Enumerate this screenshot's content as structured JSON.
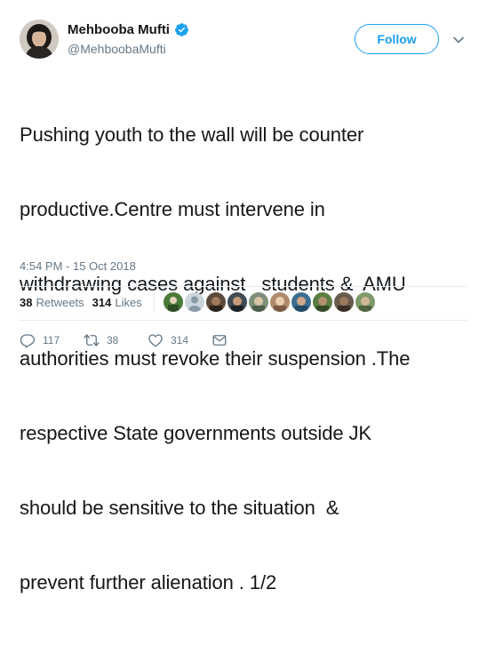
{
  "user": {
    "display_name": "Mehbooba Mufti",
    "handle": "@MehboobaMufti",
    "verified": true
  },
  "follow_label": "Follow",
  "tweet": {
    "lines": [
      "Pushing youth to the wall will be counter",
      "productive.Centre must intervene in",
      "withdrawing cases against   students &  AMU",
      "authorities must revoke their suspension .The",
      "respective State governments outside JK",
      "should be sensitive to the situation  &",
      "prevent further alienation . 1/2"
    ],
    "timestamp": "4:54 PM - 15 Oct 2018"
  },
  "stats": {
    "retweets_count": "38",
    "retweets_label": "Retweets",
    "likes_count": "314",
    "likes_label": "Likes"
  },
  "actions": {
    "reply_count": "117",
    "retweet_count": "38",
    "like_count": "314"
  },
  "colors": {
    "accent": "#1da1f2",
    "text": "#14171a",
    "muted": "#657786",
    "divider": "#e6ecf0"
  },
  "icons": [
    "verified-badge-icon",
    "chevron-down-icon",
    "reply-icon",
    "retweet-icon",
    "heart-icon",
    "direct-message-icon"
  ]
}
